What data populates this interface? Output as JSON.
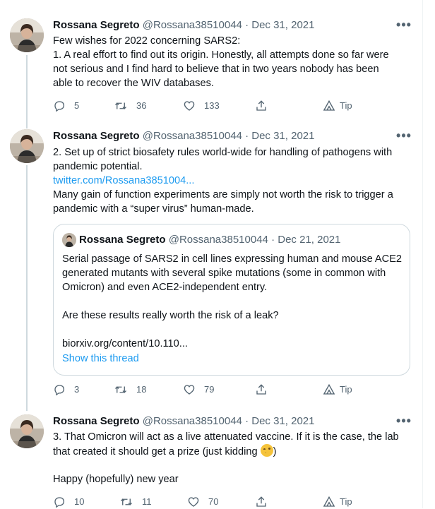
{
  "tweets": [
    {
      "name": "Rossana Segreto",
      "handle": "@Rossana38510044",
      "dot": "·",
      "date": "Dec 31, 2021",
      "more": "•••",
      "lines": [
        "Few wishes for 2022 concerning SARS2:",
        "1. A real effort to find out its origin. Honestly, all attempts done so far were",
        "not serious and I find hard to believe that in two years nobody has been",
        "able to recover the WIV databases."
      ],
      "replies": "5",
      "retweets": "36",
      "likes": "133",
      "tip": "Tip"
    },
    {
      "name": "Rossana Segreto",
      "handle": "@Rossana38510044",
      "dot": "·",
      "date": "Dec 31, 2021",
      "more": "•••",
      "lines": [
        "2. Set up of strict biosafety rules world-wide for handling of pathogens with",
        "pandemic potential."
      ],
      "link": "twitter.com/Rossana3851004...",
      "lines_after": [
        "Many gain of function experiments are simply not worth the risk to trigger a",
        "pandemic with a “super virus” human-made."
      ],
      "quote": {
        "name": "Rossana Segreto",
        "handle": "@Rossana38510044",
        "dot": "·",
        "date": "Dec 21, 2021",
        "lines": [
          "Serial passage of SARS2 in cell lines expressing human and mouse ACE2",
          "generated mutants with several spike mutations (some in common with",
          "Omicron) and even ACE2-independent entry.",
          "",
          "Are these results really worth the risk of a leak?",
          "",
          "biorxiv.org/content/10.110..."
        ],
        "show_thread": "Show this thread"
      },
      "replies": "3",
      "retweets": "18",
      "likes": "79",
      "tip": "Tip"
    },
    {
      "name": "Rossana Segreto",
      "handle": "@Rossana38510044",
      "dot": "·",
      "date": "Dec 31, 2021",
      "more": "•••",
      "line1": "3. That Omicron will act as a live attenuated vaccine. If it is the case, the lab",
      "line2": "that created it should get a prize (just kidding ",
      "line2_end": ")",
      "line3": "",
      "line4": "Happy (hopefully) new year",
      "replies": "10",
      "retweets": "11",
      "likes": "70",
      "tip": "Tip"
    }
  ],
  "colors": {
    "link": "#1d9bf0",
    "secondary_text": "#536471",
    "border": "#cfd9de"
  }
}
